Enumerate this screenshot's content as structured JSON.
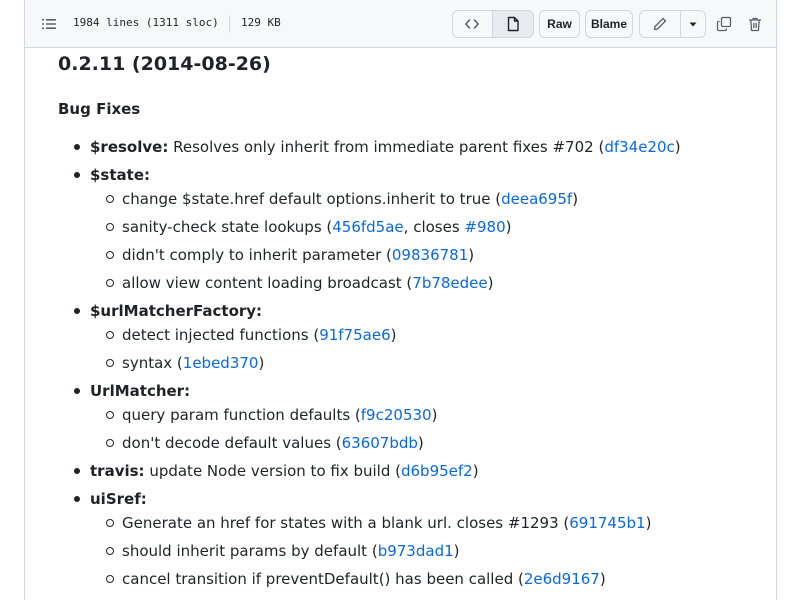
{
  "toolbar": {
    "lines_info": "1984 lines (1311 sloc)",
    "size_info": "129 KB",
    "raw_label": "Raw",
    "blame_label": "Blame"
  },
  "doc": {
    "version_heading": "0.2.11 (2014-08-26)",
    "section_heading": "Bug Fixes",
    "items": {
      "resolve": {
        "key": "$resolve:",
        "text": " Resolves only inherit from immediate parent fixes #702 (",
        "sha": "df34e20c",
        "end": ")"
      },
      "state": {
        "key": "$state:",
        "sub": [
          {
            "text": "change $state.href default options.inherit to true (",
            "sha": "deea695f",
            "end": ")"
          },
          {
            "text": "sanity-check state lookups (",
            "sha": "456fd5ae",
            "mid": ", closes ",
            "sha2": "#980",
            "end": ")"
          },
          {
            "text": "didn't comply to inherit parameter (",
            "sha": "09836781",
            "end": ")"
          },
          {
            "text": "allow view content loading broadcast (",
            "sha": "7b78edee",
            "end": ")"
          }
        ]
      },
      "urlMatcherFactory": {
        "key": "$urlMatcherFactory:",
        "sub": [
          {
            "text": "detect injected functions (",
            "sha": "91f75ae6",
            "end": ")"
          },
          {
            "text": "syntax (",
            "sha": "1ebed370",
            "end": ")"
          }
        ]
      },
      "urlMatcher": {
        "key": "UrlMatcher:",
        "sub": [
          {
            "text": "query param function defaults (",
            "sha": "f9c20530",
            "end": ")"
          },
          {
            "text": "don't decode default values (",
            "sha": "63607bdb",
            "end": ")"
          }
        ]
      },
      "travis": {
        "key": "travis:",
        "text": " update Node version to fix build (",
        "sha": "d6b95ef2",
        "end": ")"
      },
      "uiSref": {
        "key": "uiSref:",
        "sub": [
          {
            "text": "Generate an href for states with a blank url. closes #1293 (",
            "sha": "691745b1",
            "end": ")"
          },
          {
            "text": "should inherit params by default (",
            "sha": "b973dad1",
            "end": ")"
          },
          {
            "text": "cancel transition if preventDefault() has been called (",
            "sha": "2e6d9167",
            "end": ")"
          }
        ]
      }
    }
  }
}
